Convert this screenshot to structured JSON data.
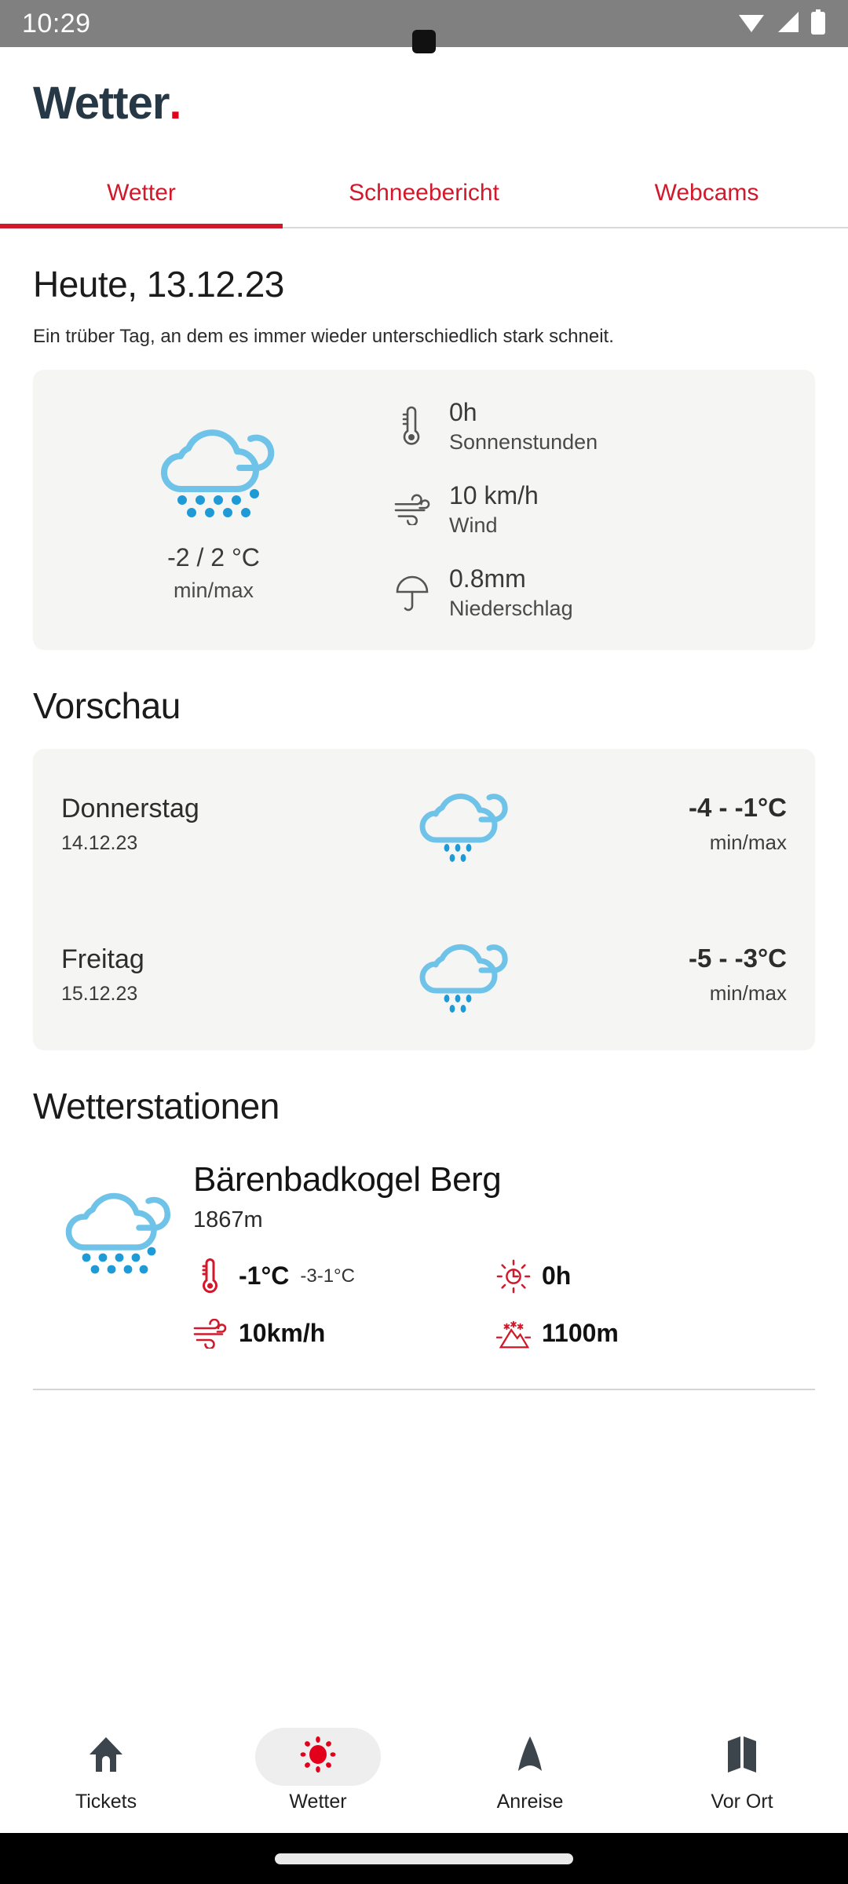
{
  "status_bar": {
    "time": "10:29",
    "icons": [
      "wifi-icon",
      "signal-icon",
      "battery-icon"
    ]
  },
  "brand": {
    "name": "Wetter",
    "dot": ".",
    "color": "#263845",
    "accent": "#e2001a"
  },
  "tabs": {
    "active_index": 0,
    "items": [
      {
        "label": "Wetter"
      },
      {
        "label": "Schneebericht"
      },
      {
        "label": "Webcams"
      }
    ],
    "color": "#d2182b"
  },
  "today": {
    "title": "Heute, 13.12.23",
    "description": "Ein trüber Tag, an dem es immer wieder unterschiedlich stark schneit.",
    "icon": "snow-cloud-icon",
    "temperature": "-2 / 2 °C",
    "temperature_label": "min/max",
    "stats": [
      {
        "icon": "thermometer-icon",
        "value": "0h",
        "label": "Sonnenstunden"
      },
      {
        "icon": "wind-icon",
        "value": "10 km/h",
        "label": "Wind"
      },
      {
        "icon": "umbrella-icon",
        "value": "0.8mm",
        "label": "Niederschlag"
      }
    ]
  },
  "forecast": {
    "title": "Vorschau",
    "days": [
      {
        "day": "Donnerstag",
        "date": "14.12.23",
        "icon": "rain-cloud-icon",
        "range": "-4 - -1°C",
        "range_label": "min/max"
      },
      {
        "day": "Freitag",
        "date": "15.12.23",
        "icon": "rain-cloud-icon",
        "range": "-5 - -3°C",
        "range_label": "min/max"
      }
    ]
  },
  "stations": {
    "title": "Wetterstationen",
    "items": [
      {
        "icon": "snow-cloud-icon",
        "name": "Bärenbadkogel Berg",
        "altitude": "1867m",
        "stats": [
          {
            "icon": "thermometer-icon",
            "value": "-1°C",
            "sub": "-3-1°C"
          },
          {
            "icon": "sun-hours-icon",
            "value": "0h",
            "sub": ""
          },
          {
            "icon": "wind-icon",
            "value": "10km/h",
            "sub": ""
          },
          {
            "icon": "snowline-mountain-icon",
            "value": "1100m",
            "sub": ""
          }
        ]
      }
    ]
  },
  "bottom_nav": {
    "active_index": 1,
    "items": [
      {
        "label": "Tickets",
        "icon": "home-icon"
      },
      {
        "label": "Wetter",
        "icon": "sun-icon"
      },
      {
        "label": "Anreise",
        "icon": "navigation-arrow-icon"
      },
      {
        "label": "Vor Ort",
        "icon": "map-icon"
      }
    ]
  },
  "colors": {
    "brand_dark": "#263845",
    "accent_red": "#e2001a",
    "tab_red": "#d2182b",
    "cloud_light": "#6fc3e8",
    "cloud_dot": "#1e9ad6",
    "card_bg": "#f5f5f3"
  }
}
